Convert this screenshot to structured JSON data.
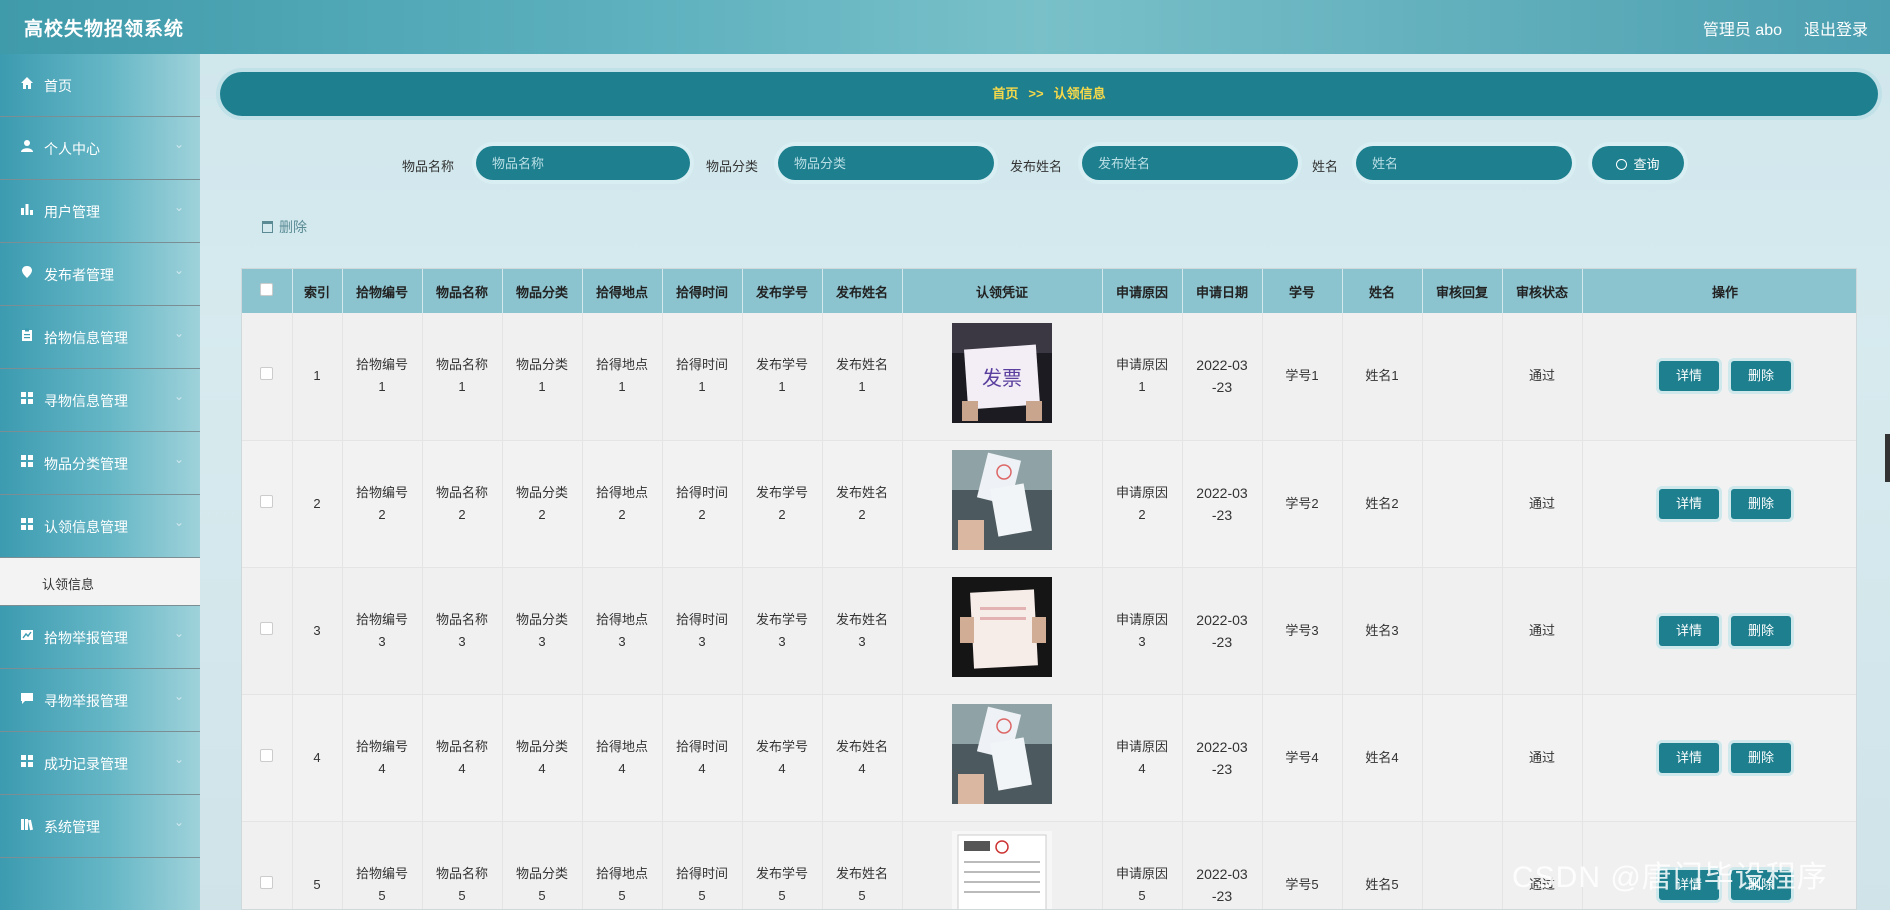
{
  "header": {
    "title": "高校失物招领系统",
    "user": "管理员 abo",
    "logout": "退出登录"
  },
  "sidebar": {
    "items": [
      {
        "label": "首页",
        "icon": "home-icon",
        "chevron": false
      },
      {
        "label": "个人中心",
        "icon": "user-icon",
        "chevron": true
      },
      {
        "label": "用户管理",
        "icon": "bar-chart-icon",
        "chevron": true
      },
      {
        "label": "发布者管理",
        "icon": "location-pin-icon",
        "chevron": true
      },
      {
        "label": "拾物信息管理",
        "icon": "clipboard-icon",
        "chevron": true
      },
      {
        "label": "寻物信息管理",
        "icon": "grid-icon",
        "chevron": true
      },
      {
        "label": "物品分类管理",
        "icon": "grid-icon",
        "chevron": true
      },
      {
        "label": "认领信息管理",
        "icon": "grid-icon",
        "chevron": true
      },
      {
        "label": "拾物举报管理",
        "icon": "chart-icon",
        "chevron": true
      },
      {
        "label": "寻物举报管理",
        "icon": "message-icon",
        "chevron": true
      },
      {
        "label": "成功记录管理",
        "icon": "grid-icon",
        "chevron": true
      },
      {
        "label": "系统管理",
        "icon": "library-icon",
        "chevron": true
      }
    ],
    "submenu_label": "认领信息"
  },
  "breadcrumb": {
    "home": "首页",
    "sep": ">>",
    "current": "认领信息"
  },
  "search": {
    "fields": [
      {
        "label": "物品名称",
        "placeholder": "物品名称"
      },
      {
        "label": "物品分类",
        "placeholder": "物品分类"
      },
      {
        "label": "发布姓名",
        "placeholder": "发布姓名"
      },
      {
        "label": "姓名",
        "placeholder": "姓名"
      }
    ],
    "button": "查询"
  },
  "toolbar": {
    "delete": "删除"
  },
  "table": {
    "headers": [
      "",
      "索引",
      "拾物编号",
      "物品名称",
      "物品分类",
      "拾得地点",
      "拾得时间",
      "发布学号",
      "发布姓名",
      "认领凭证",
      "申请原因",
      "申请日期",
      "学号",
      "姓名",
      "审核回复",
      "审核状态",
      "操作"
    ],
    "rows": [
      {
        "index": "1",
        "no": [
          "拾物编号",
          "1"
        ],
        "name": [
          "物品名称",
          "1"
        ],
        "cat": [
          "物品分类",
          "1"
        ],
        "place": [
          "拾得地点",
          "1"
        ],
        "time": [
          "拾得时间",
          "1"
        ],
        "pub_id": [
          "发布学号",
          "1"
        ],
        "pub_name": [
          "发布姓名",
          "1"
        ],
        "reason": [
          "申请原因",
          "1"
        ],
        "date": [
          "2022-03",
          "-23"
        ],
        "sid": "学号1",
        "sname": "姓名1",
        "reply": "",
        "status": "通过",
        "image": "invoice-photo",
        "image_text": "发票"
      },
      {
        "index": "2",
        "no": [
          "拾物编号",
          "2"
        ],
        "name": [
          "物品名称",
          "2"
        ],
        "cat": [
          "物品分类",
          "2"
        ],
        "place": [
          "拾得地点",
          "2"
        ],
        "time": [
          "拾得时间",
          "2"
        ],
        "pub_id": [
          "发布学号",
          "2"
        ],
        "pub_name": [
          "发布姓名",
          "2"
        ],
        "reason": [
          "申请原因",
          "2"
        ],
        "date": [
          "2022-03",
          "-23"
        ],
        "sid": "学号2",
        "sname": "姓名2",
        "reply": "",
        "status": "通过",
        "image": "receipt-in-car-photo",
        "image_text": ""
      },
      {
        "index": "3",
        "no": [
          "拾物编号",
          "3"
        ],
        "name": [
          "物品名称",
          "3"
        ],
        "cat": [
          "物品分类",
          "3"
        ],
        "place": [
          "拾得地点",
          "3"
        ],
        "time": [
          "拾得时间",
          "3"
        ],
        "pub_id": [
          "发布学号",
          "3"
        ],
        "pub_name": [
          "发布姓名",
          "3"
        ],
        "reason": [
          "申请原因",
          "3"
        ],
        "date": [
          "2022-03",
          "-23"
        ],
        "sid": "学号3",
        "sname": "姓名3",
        "reply": "",
        "status": "通过",
        "image": "document-hands-photo",
        "image_text": ""
      },
      {
        "index": "4",
        "no": [
          "拾物编号",
          "4"
        ],
        "name": [
          "物品名称",
          "4"
        ],
        "cat": [
          "物品分类",
          "4"
        ],
        "place": [
          "拾得地点",
          "4"
        ],
        "time": [
          "拾得时间",
          "4"
        ],
        "pub_id": [
          "发布学号",
          "4"
        ],
        "pub_name": [
          "发布姓名",
          "4"
        ],
        "reason": [
          "申请原因",
          "4"
        ],
        "date": [
          "2022-03",
          "-23"
        ],
        "sid": "学号4",
        "sname": "姓名4",
        "reply": "",
        "status": "通过",
        "image": "receipt-in-car-photo",
        "image_text": ""
      },
      {
        "index": "5",
        "no": [
          "拾物编号",
          "5"
        ],
        "name": [
          "物品名称",
          "5"
        ],
        "cat": [
          "物品分类",
          "5"
        ],
        "place": [
          "拾得地点",
          "5"
        ],
        "time": [
          "拾得时间",
          "5"
        ],
        "pub_id": [
          "发布学号",
          "5"
        ],
        "pub_name": [
          "发布姓名",
          "5"
        ],
        "reason": [
          "申请原因",
          "5"
        ],
        "date": [
          "2022-03",
          "-23"
        ],
        "sid": "学号5",
        "sname": "姓名5",
        "reply": "",
        "status": "通过",
        "image": "paper-form-photo",
        "image_text": ""
      }
    ],
    "ops": {
      "detail": "详情",
      "delete": "删除"
    }
  },
  "watermark": "CSDN @唐门毕设程序",
  "colors": {
    "primary": "#1e7f8f",
    "accent": "#f5d94a",
    "header_row": "#8bc3cf"
  }
}
